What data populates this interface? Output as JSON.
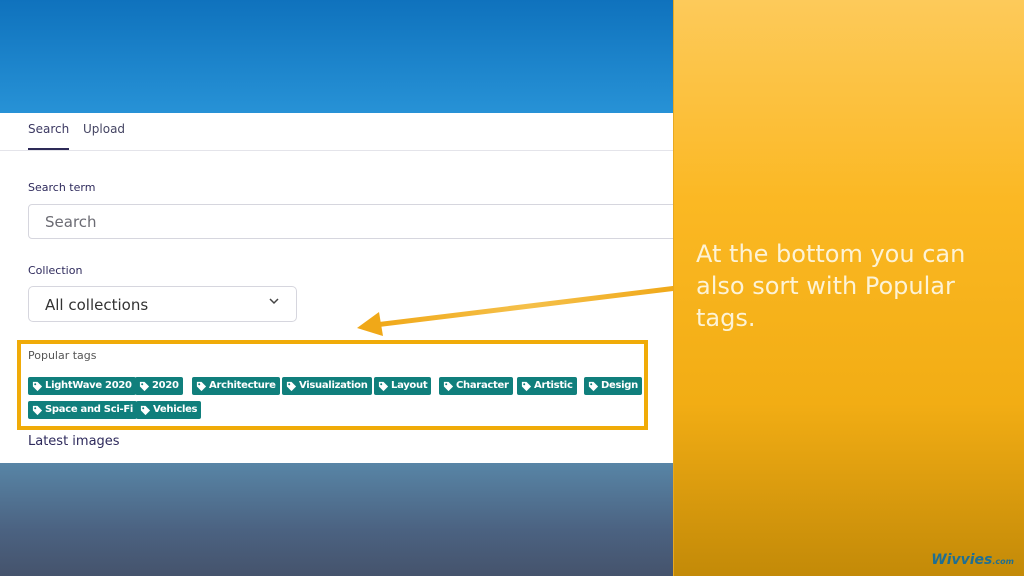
{
  "tabs": [
    {
      "label": "Search",
      "active": true
    },
    {
      "label": "Upload",
      "active": false
    }
  ],
  "search": {
    "label": "Search term",
    "placeholder": "Search",
    "value": ""
  },
  "collection": {
    "label": "Collection",
    "selected": "All collections",
    "icon": "chevron-down-icon"
  },
  "popular_tags": {
    "title": "Popular tags",
    "icon": "tag-icon",
    "items": [
      "LightWave 2020",
      "2020",
      "Architecture",
      "Visualization",
      "Layout",
      "Character",
      "Artistic",
      "Design",
      "Space and Sci-Fi",
      "Vehicles"
    ]
  },
  "latest_images": {
    "title": "Latest images"
  },
  "callout": {
    "text": "At the bottom you can also sort with Popular tags."
  },
  "branding": {
    "logo": "Wivvies",
    "logo_suffix": ".com"
  },
  "colors": {
    "tag_bg": "#107f7c",
    "highlight": "#f0ab08",
    "heading_text": "#2e2a5c",
    "top_banner": "#1a82c8",
    "side_panel": "#fbb823"
  }
}
